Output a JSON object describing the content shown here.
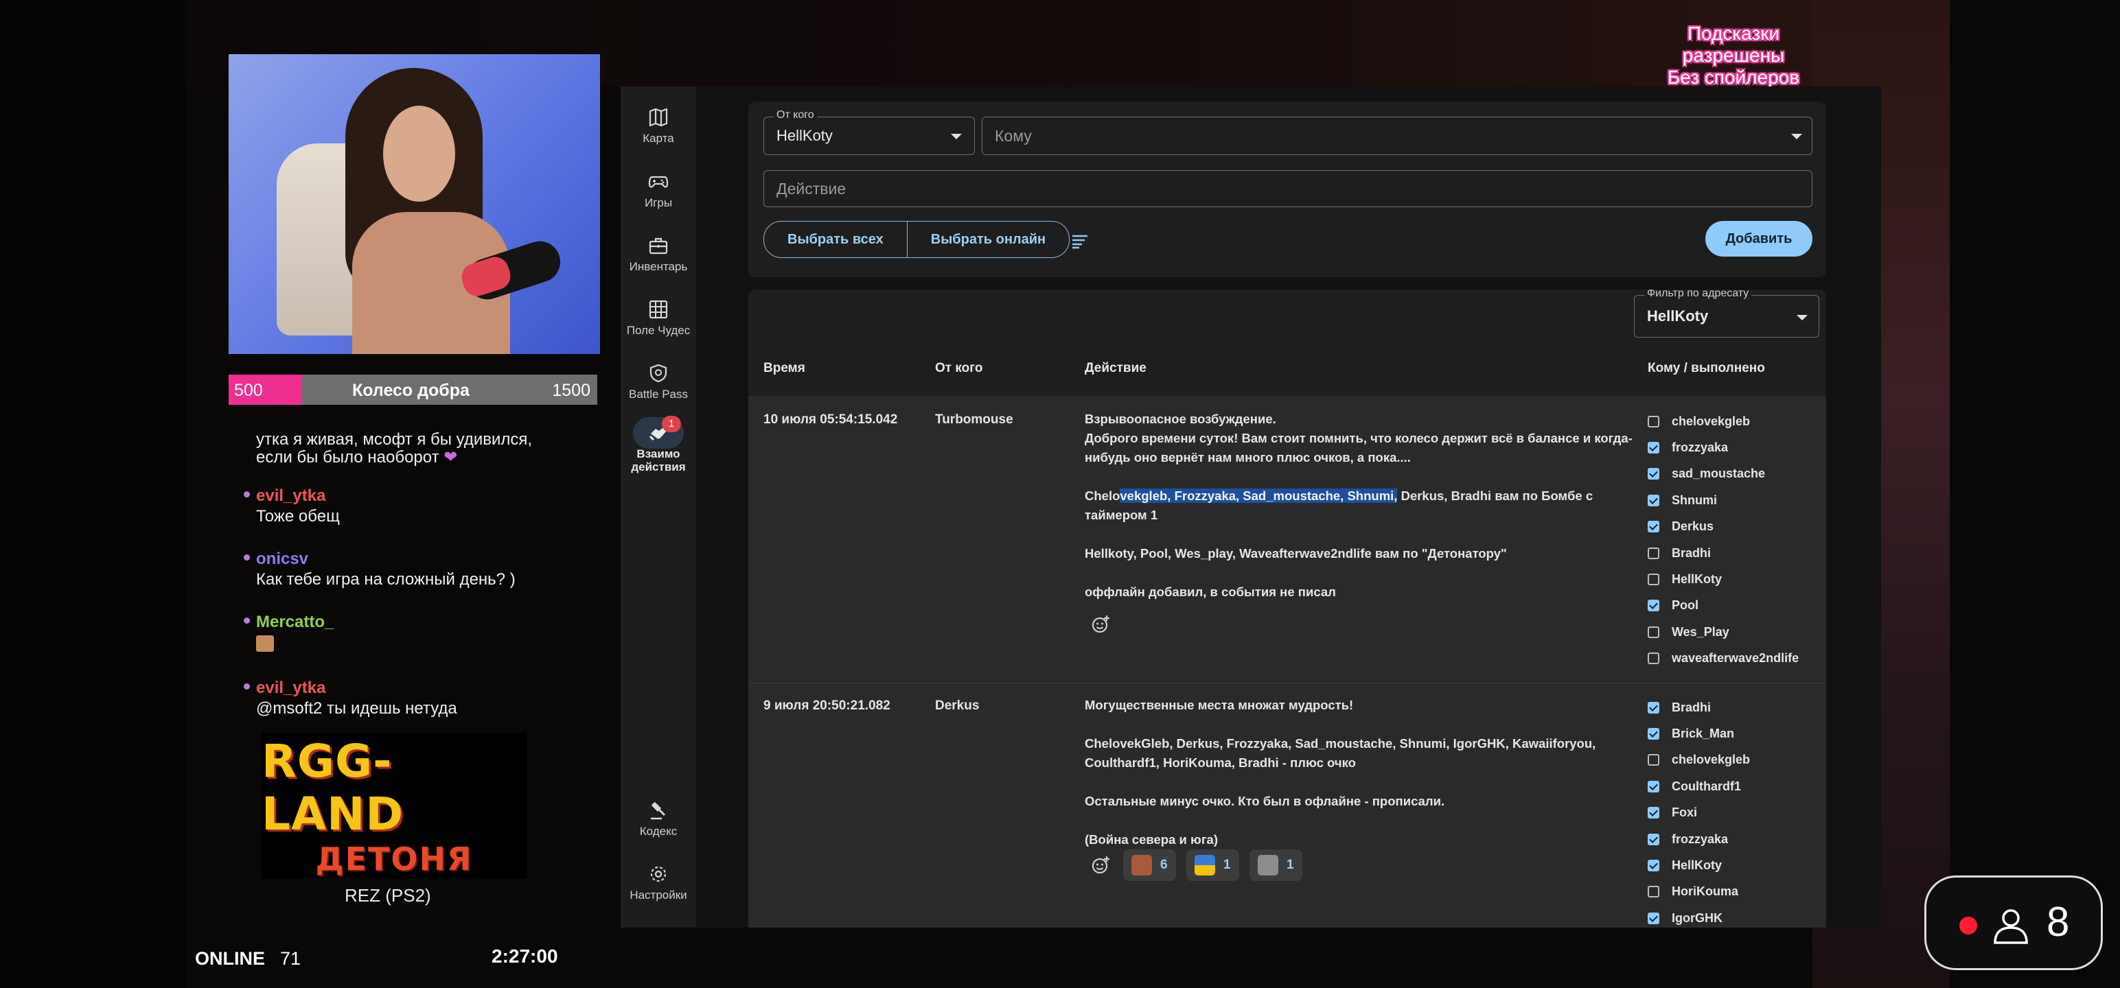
{
  "stream": {
    "hints": [
      "Подсказки разрешены",
      "Без спойлеров"
    ],
    "goal": {
      "min": "500",
      "title": "Колесо добра",
      "max": "1500",
      "progress_fraction": 0.2
    },
    "chat": [
      {
        "name": "",
        "text_lines": [
          "утка я живая, мсофт я бы удивился,",
          "если бы было наоборот"
        ]
      },
      {
        "name": "evil_ytka",
        "name_color": "#e8575a",
        "text": "Тоже обещ"
      },
      {
        "name": "onicsv",
        "name_color": "#8a7cf0",
        "text": "Как тебе игра на сложный день? )"
      },
      {
        "name": "Mercatto_",
        "name_color": "#8fd14f",
        "text": ""
      },
      {
        "name": "evil_ytka",
        "name_color": "#e8575a",
        "text": "@msoft2 ты идешь нетуда"
      }
    ],
    "logo": {
      "line1": "RGG-LAND",
      "line2": "ДЕТОНЯ"
    },
    "game": "REZ (PS2)",
    "online_label": "ONLINE",
    "online_count": "71",
    "timer": "2:27:00",
    "viewers": "8"
  },
  "sidebar": {
    "items": [
      {
        "label": "Карта",
        "icon": "map-icon"
      },
      {
        "label": "Игры",
        "icon": "gamepad-icon"
      },
      {
        "label": "Инвентарь",
        "icon": "briefcase-icon"
      },
      {
        "label": "Поле Чудес",
        "icon": "grid-icon"
      },
      {
        "label": "Battle Pass",
        "icon": "shield-icon"
      },
      {
        "label_lines": [
          "Взаимо",
          "действия"
        ],
        "icon": "handshake-icon",
        "badge": "1",
        "active": true
      },
      {
        "label": "Кодекс",
        "icon": "gavel-icon"
      },
      {
        "label": "Настройки",
        "icon": "gear-icon"
      }
    ]
  },
  "form": {
    "from_legend": "От кого",
    "from_value": "HellKoty",
    "to_placeholder": "Кому",
    "action_placeholder": "Действие",
    "select_all": "Выбрать всех",
    "select_online": "Выбрать онлайн",
    "add_button": "Добавить"
  },
  "table": {
    "filter_legend": "Фильтр по адресату",
    "filter_value": "HellKoty",
    "headers": {
      "time": "Время",
      "from": "От кого",
      "action": "Действие",
      "to": "Кому / выполнено"
    },
    "rows": [
      {
        "time": "10 июля 05:54:15.042",
        "from": "Turbomouse",
        "action": {
          "line1": "Взрывоопасное возбуждение.",
          "line2": "Доброго времени суток! Вам стоит помнить, что колесо держит всё в балансе и когда-",
          "line3": "нибудь оно вернёт нам много плюс очков, а пока....",
          "line4_pre": "Chelo",
          "line4_hl": "vekgleb, Frozzyaka, Sad_moustache, Shnumi,",
          "line4_post": " Derkus, Bradhi вам по Бомбе с",
          "line5": "таймером 1",
          "line6": "Hellkoty, Pool, Wes_play, Waveafterwave2ndlife вам по \"Детонатору\"",
          "line7": "оффлайн добавил, в события не писал"
        },
        "recipients": [
          {
            "name": "chelovekgleb",
            "done": false
          },
          {
            "name": "frozzyaka",
            "done": true
          },
          {
            "name": "sad_moustache",
            "done": true
          },
          {
            "name": "Shnumi",
            "done": true
          },
          {
            "name": "Derkus",
            "done": true
          },
          {
            "name": "Bradhi",
            "done": false
          },
          {
            "name": "HellKoty",
            "done": false
          },
          {
            "name": "Pool",
            "done": true
          },
          {
            "name": "Wes_Play",
            "done": false
          },
          {
            "name": "waveafterwave2ndlife",
            "done": false
          }
        ]
      },
      {
        "time": "9 июля 20:50:21.082",
        "from": "Derkus",
        "action": {
          "line1": "Могущественные места множат мудрость!",
          "line2": "ChelovekGleb, Derkus, Frozzyaka, Sad_moustache, Shnumi, IgorGHK, Kawaiiforyou,",
          "line3": "Coulthardf1, HoriKouma, Bradhi - плюс очко",
          "line4": "Остальные минус очко. Кто был в офлайне - прописали.",
          "line5": "(Война севера и юга)"
        },
        "reactions": [
          "6",
          "1",
          "1"
        ],
        "recipients": [
          {
            "name": "Bradhi",
            "done": true
          },
          {
            "name": "Brick_Man",
            "done": true
          },
          {
            "name": "chelovekgleb",
            "done": false
          },
          {
            "name": "Coulthardf1",
            "done": true
          },
          {
            "name": "Foxi",
            "done": true
          },
          {
            "name": "frozzyaka",
            "done": true
          },
          {
            "name": "HellKoty",
            "done": true
          },
          {
            "name": "HoriKouma",
            "done": false
          },
          {
            "name": "IgorGHK",
            "done": true
          }
        ]
      }
    ]
  }
}
